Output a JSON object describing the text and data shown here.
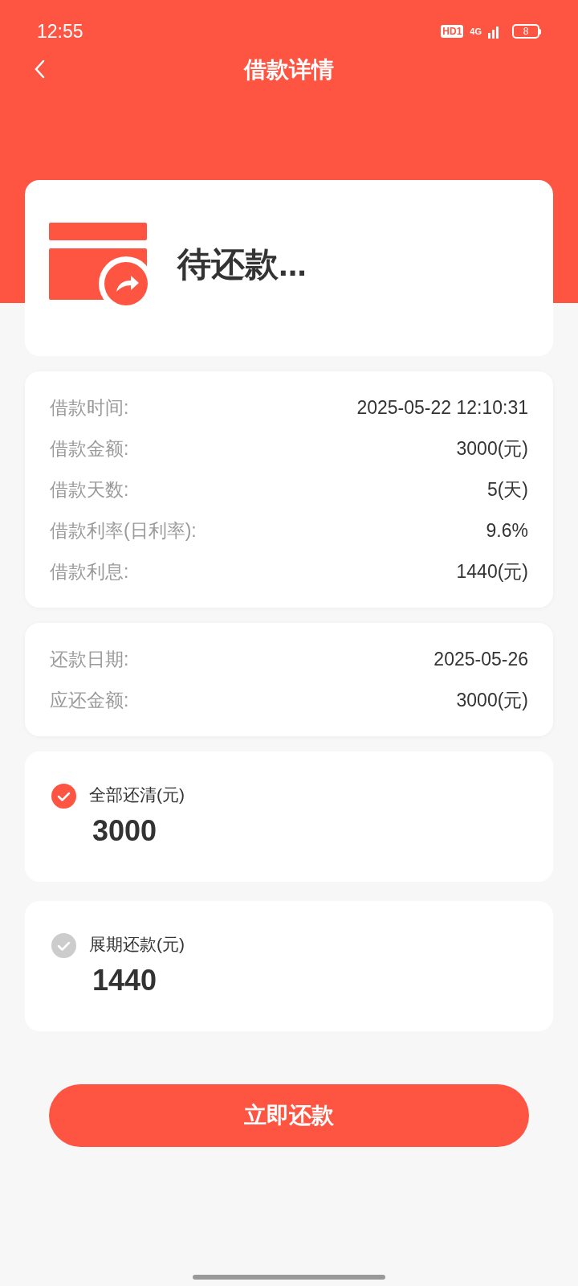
{
  "status_bar": {
    "time": "12:55",
    "hd": "HD1",
    "network": "4G",
    "battery": "8"
  },
  "nav": {
    "title": "借款详情"
  },
  "status_card": {
    "status": "待还款..."
  },
  "loan_details": [
    {
      "label": "借款时间:",
      "value": "2025-05-22 12:10:31"
    },
    {
      "label": "借款金额:",
      "value": "3000(元)"
    },
    {
      "label": "借款天数:",
      "value": "5(天)"
    },
    {
      "label": "借款利率(日利率):",
      "value": "9.6%"
    },
    {
      "label": "借款利息:",
      "value": "1440(元)"
    }
  ],
  "repayment_details": [
    {
      "label": "还款日期:",
      "value": "2025-05-26"
    },
    {
      "label": "应还金额:",
      "value": "3000(元)"
    }
  ],
  "repay_options": [
    {
      "label": "全部还清(元)",
      "amount": "3000",
      "selected": true
    },
    {
      "label": "展期还款(元)",
      "amount": "1440",
      "selected": false
    }
  ],
  "submit_button": "立即还款"
}
